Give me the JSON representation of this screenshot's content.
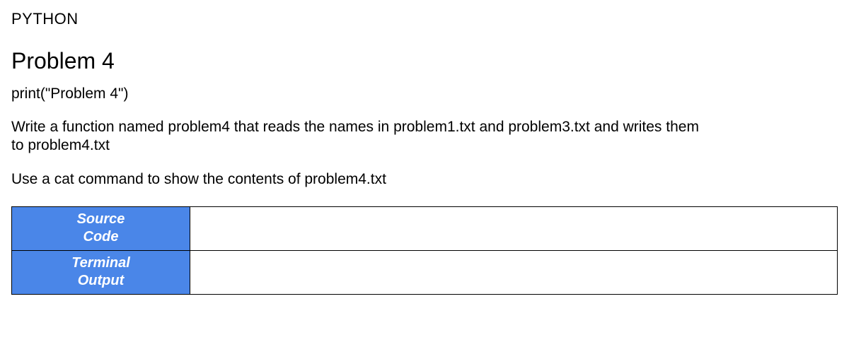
{
  "header": {
    "language": "PYTHON"
  },
  "problem": {
    "title": "Problem 4",
    "codeLine": "print(\"Problem 4\")",
    "description": "Write a function named problem4 that reads the names in problem1.txt and problem3.txt and writes them to problem4.txt",
    "instruction": "Use a cat command to show the contents of problem4.txt"
  },
  "table": {
    "rows": [
      {
        "label": "Source\nCode",
        "content": ""
      },
      {
        "label": "Terminal\nOutput",
        "content": ""
      }
    ]
  }
}
